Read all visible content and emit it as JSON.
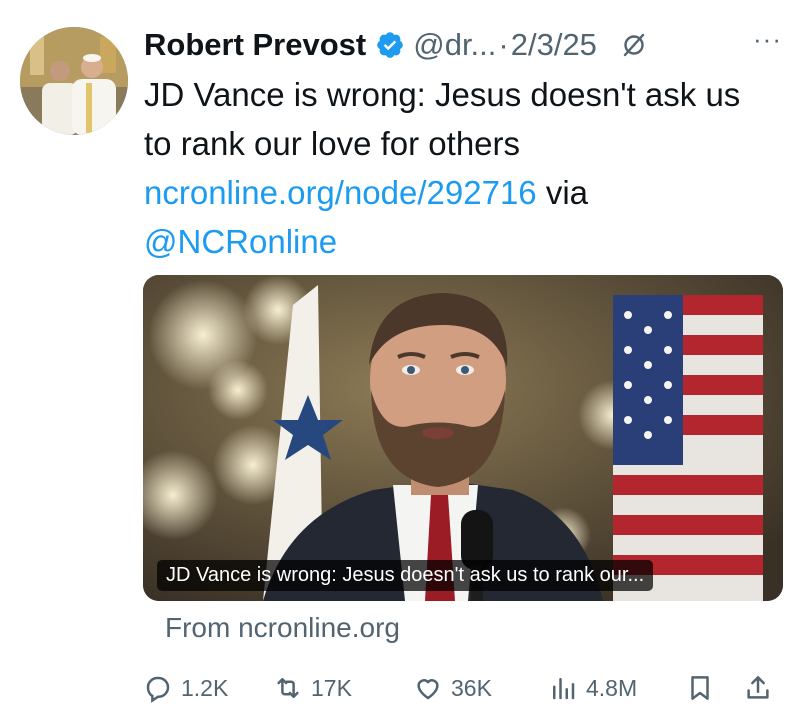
{
  "author": {
    "name": "Robert Prevost",
    "handle": "@dr...",
    "separator": "·",
    "date": "2/3/25"
  },
  "tweet": {
    "text_line": "JD Vance is wrong: Jesus doesn't ask us to rank our love for others",
    "link_url": "ncronline.org/node/292716",
    "via": " via ",
    "mention": "@NCRonline"
  },
  "card": {
    "caption": "JD Vance is wrong: Jesus doesn't ask us to rank our...",
    "source": "From ncronline.org"
  },
  "actions": {
    "replies": "1.2K",
    "reposts": "17K",
    "likes": "36K",
    "views": "4.8M"
  },
  "colors": {
    "link": "#1d9bf0",
    "secondary_text": "#536471",
    "primary_text": "#0f1419"
  }
}
